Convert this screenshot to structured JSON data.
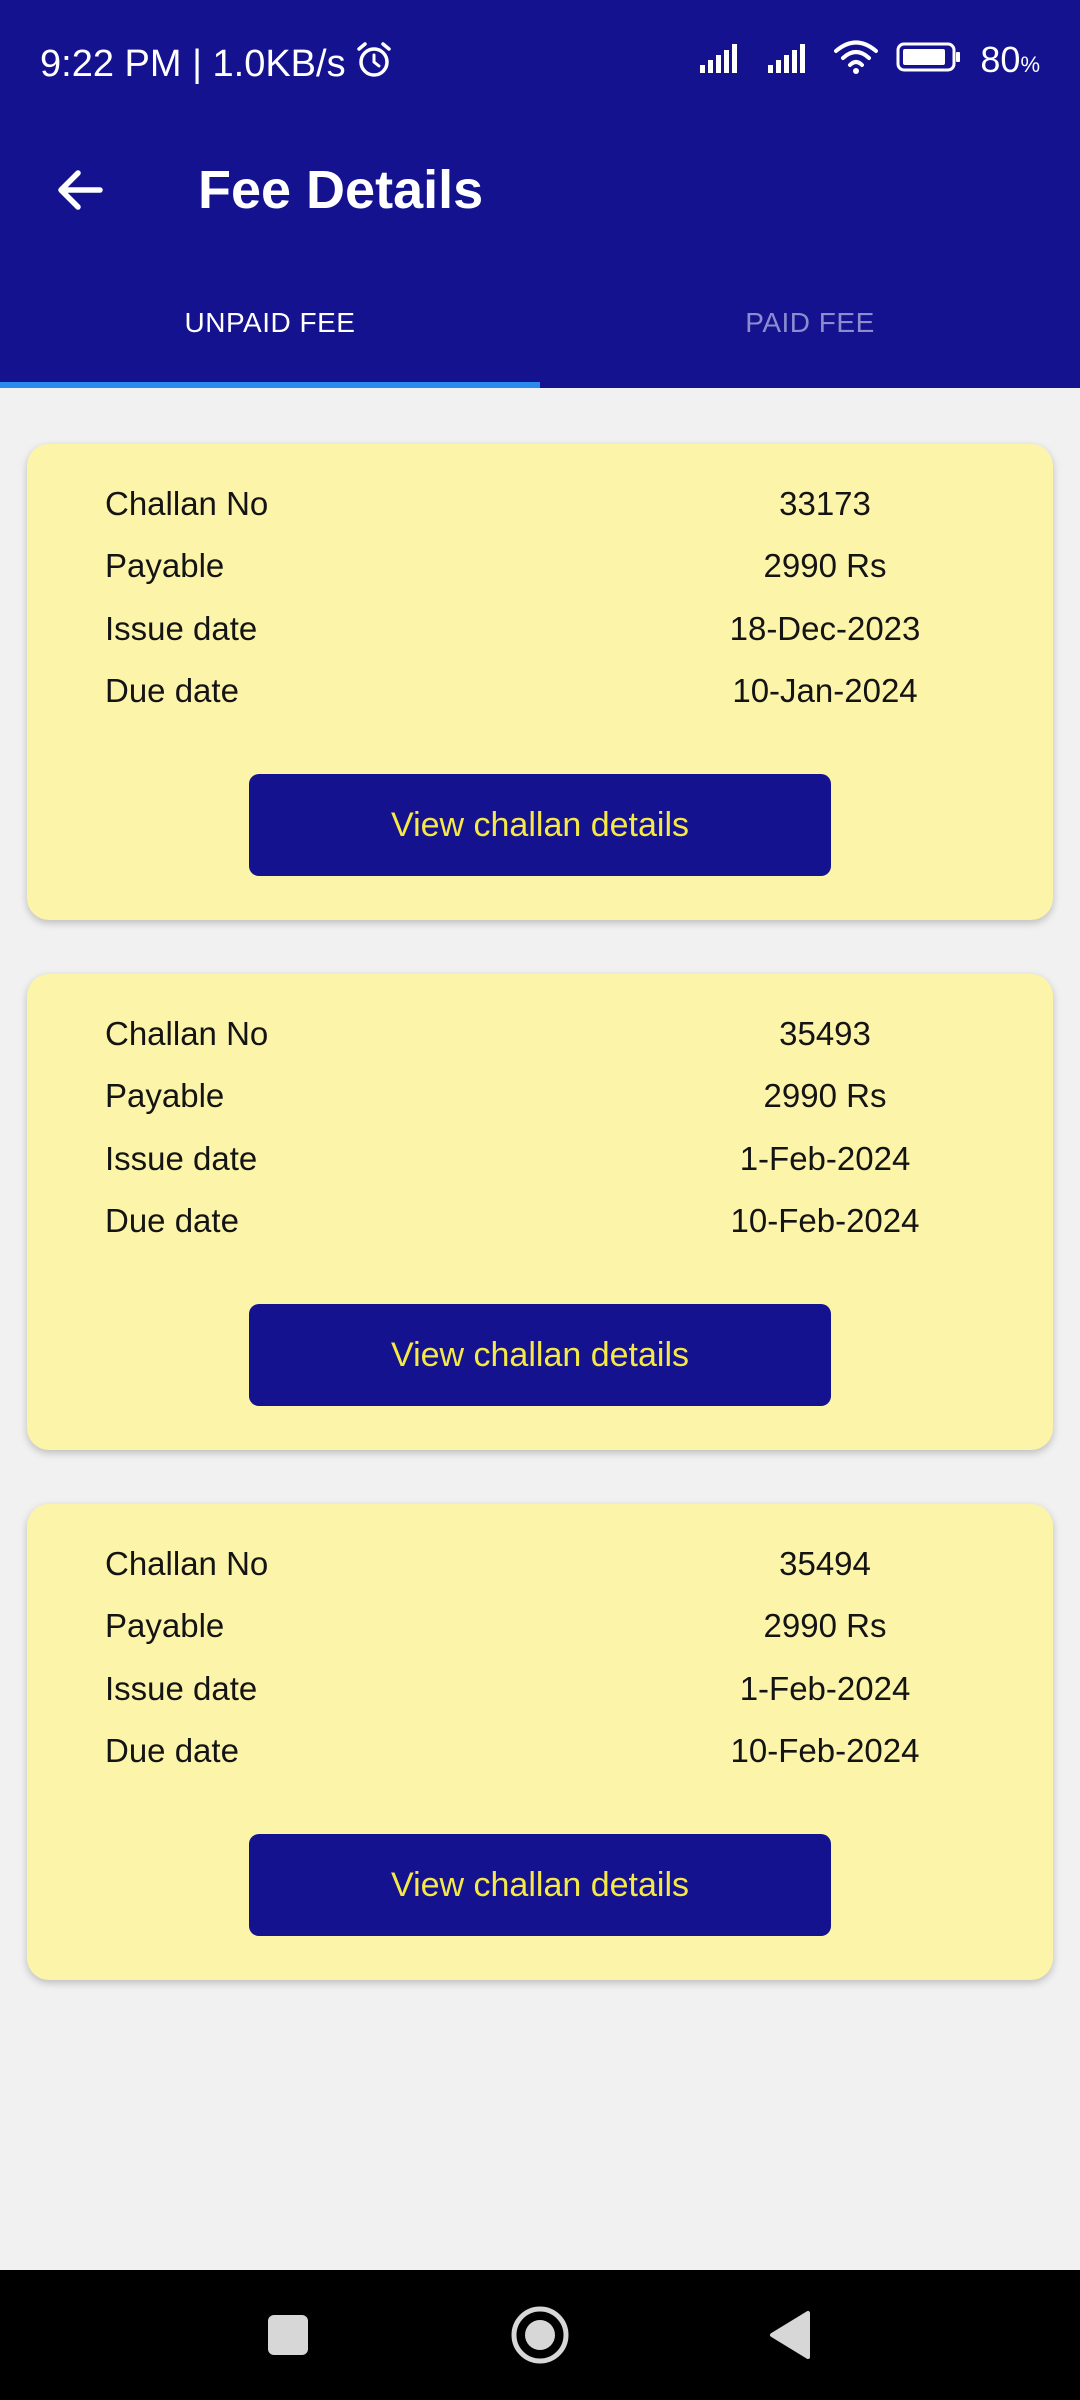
{
  "status_bar": {
    "time_speed": "9:22 PM | 1.0KB/s",
    "battery_percent": "80",
    "battery_unit": "%",
    "icons": [
      "alarm-icon",
      "signal-icon",
      "signal-icon",
      "wifi-icon",
      "battery-icon"
    ]
  },
  "app_bar": {
    "title": "Fee Details",
    "back_icon": "arrow-left-icon"
  },
  "tabs": [
    {
      "label": "UNPAID FEE",
      "active": true
    },
    {
      "label": "PAID FEE",
      "active": false
    }
  ],
  "challans": [
    {
      "rows": [
        {
          "label": "Challan No",
          "value": "33173"
        },
        {
          "label": "Payable",
          "value": "2990 Rs"
        },
        {
          "label": "Issue date",
          "value": "18-Dec-2023"
        },
        {
          "label": "Due date",
          "value": "10-Jan-2024"
        }
      ],
      "button": "View challan details"
    },
    {
      "rows": [
        {
          "label": "Challan No",
          "value": "35493"
        },
        {
          "label": "Payable",
          "value": "2990 Rs"
        },
        {
          "label": "Issue date",
          "value": "1-Feb-2024"
        },
        {
          "label": "Due date",
          "value": "10-Feb-2024"
        }
      ],
      "button": "View challan details"
    },
    {
      "rows": [
        {
          "label": "Challan No",
          "value": "35494"
        },
        {
          "label": "Payable",
          "value": "2990 Rs"
        },
        {
          "label": "Issue date",
          "value": "1-Feb-2024"
        },
        {
          "label": "Due date",
          "value": "10-Feb-2024"
        }
      ],
      "button": "View challan details"
    }
  ],
  "nav_bar": {
    "icons": [
      "recents-icon",
      "home-icon",
      "back-triangle-icon"
    ]
  },
  "colors": {
    "primary": "#14128f",
    "card_background": "#fcf4a9",
    "button_text": "#f6e845",
    "tab_indicator": "#2a8bef",
    "page_background": "#f1f1f1"
  }
}
